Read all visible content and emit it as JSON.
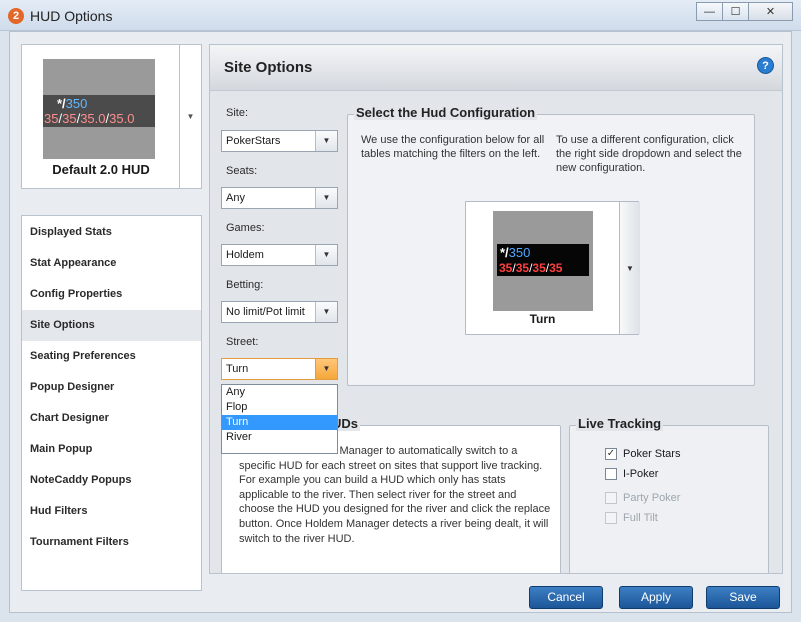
{
  "window": {
    "title": "HUD Options",
    "app_badge": "2",
    "minimize": "—",
    "maximize": "☐",
    "close": "✕"
  },
  "profile": {
    "name": "Default 2.0 HUD",
    "hud_line1_prefix": "*/",
    "hud_line1_value": "350",
    "hud_line2": [
      "35",
      "35",
      "35.0",
      "35.0"
    ]
  },
  "nav": {
    "items": [
      "Displayed Stats",
      "Stat Appearance",
      "Config Properties",
      "Site Options",
      "Seating Preferences",
      "Popup Designer",
      "Chart Designer",
      "Main Popup",
      "NoteCaddy Popups",
      "Hud Filters",
      "Tournament Filters"
    ],
    "active": "Site Options"
  },
  "main": {
    "title": "Site Options",
    "help_icon": "?",
    "site_label": "Site:",
    "site_value": "PokerStars",
    "seats_label": "Seats:",
    "seats_value": "Any",
    "games_label": "Games:",
    "games_value": "Holdem",
    "betting_label": "Betting:",
    "betting_value": "No limit/Pot limit",
    "street_label": "Street:",
    "street_value": "Turn",
    "street_options": [
      "Any",
      "Flop",
      "Turn",
      "River"
    ],
    "street_selected": "Turn"
  },
  "config": {
    "title": "Select the Hud Configuration",
    "desc_left": "We use the configuration below for all tables matching the filters on the left.",
    "desc_right": "To use a different configuration, click the right side dropdown and select the new configuration.",
    "hud_line1_prefix": "*/",
    "hud_line1_value": "350",
    "hud_line2": [
      "35",
      "35",
      "35",
      "35"
    ],
    "name": "Turn"
  },
  "street_huds": {
    "title_visible": "UDs",
    "text": "You can tell Holdem Manager to automatically switch to a specific HUD for each street on sites that support live tracking. For example you can build a HUD which only has stats applicable to the river. Then select river for the street and choose the HUD you designed for the river and click the replace button. Once Holdem Manager detects a river being dealt, it will switch to the river HUD."
  },
  "live_tracking": {
    "title": "Live Tracking",
    "items": [
      {
        "label": "Poker Stars",
        "checked": "✓"
      },
      {
        "label": "I-Poker",
        "checked": ""
      },
      {
        "label": "Party Poker",
        "checked": ""
      },
      {
        "label": "Full Tilt",
        "checked": ""
      }
    ]
  },
  "buttons": {
    "cancel": "Cancel",
    "apply": "Apply",
    "save": "Save"
  },
  "colors": {
    "accent": "#2a6db5",
    "hud_blue": "#4da8ff",
    "hud_red": "#ff3f3f",
    "dropdown_open": "#f5a73b"
  }
}
